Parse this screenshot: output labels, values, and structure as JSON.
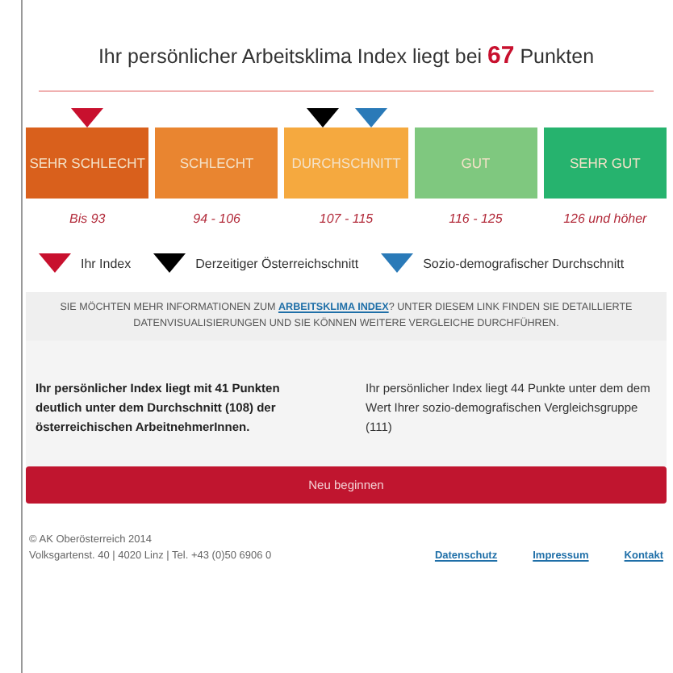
{
  "headline": {
    "before": "Ihr persönlicher Arbeitsklima Index liegt bei",
    "score": "67",
    "after": "Punkten"
  },
  "segments": [
    {
      "label": "SEHR SCHLECHT",
      "range": "Bis 93",
      "color": "#d9601c",
      "markers": [
        {
          "kind": "own"
        }
      ]
    },
    {
      "label": "SCHLECHT",
      "range": "94 - 106",
      "color": "#e98530"
    },
    {
      "label": "DURCHSCHNITT",
      "range": "107 - 115",
      "color": "#f5a93f",
      "markers": [
        {
          "kind": "national"
        },
        {
          "kind": "socio"
        }
      ]
    },
    {
      "label": "GUT",
      "range": "116 - 125",
      "color": "#7fc87f"
    },
    {
      "label": "SEHR GUT",
      "range": "126 und höher",
      "color": "#26b36e"
    }
  ],
  "legend": [
    {
      "kind": "own",
      "label": "Ihr Index"
    },
    {
      "kind": "national",
      "label": "Derzeitiger Österreichschnitt"
    },
    {
      "kind": "socio",
      "label": "Sozio-demografischer Durchschnitt"
    }
  ],
  "info": {
    "before": "SIE MÖCHTEN MEHR INFORMATIONEN ZUM",
    "link": "ARBEITSKLIMA INDEX",
    "after": "? UNTER DIESEM LINK FINDEN SIE DETAILLIERTE DATENVISUALISIERUNGEN UND SIE KÖNNEN WEITERE VERGLEICHE DURCHFÜHREN."
  },
  "comparisons": [
    {
      "text": "Ihr persönlicher Index liegt mit 41 Punkten deutlich unter dem Durchschnitt (108) der österreichischen ArbeitnehmerInnen.",
      "bold": true
    },
    {
      "text": "Ihr persönlicher Index liegt 44 Punkte unter dem dem Wert Ihrer sozio-demografischen Vergleichsgruppe (111)",
      "bold": false
    }
  ],
  "restart_button": "Neu beginnen",
  "footer": {
    "lines": [
      "© AK Oberösterreich 2014",
      "Volksgartenst. 40 | 4020 Linz | Tel. +43 (0)50 6906 0"
    ],
    "links": [
      "Datenschutz",
      "Impressum",
      "Kontakt"
    ]
  }
}
